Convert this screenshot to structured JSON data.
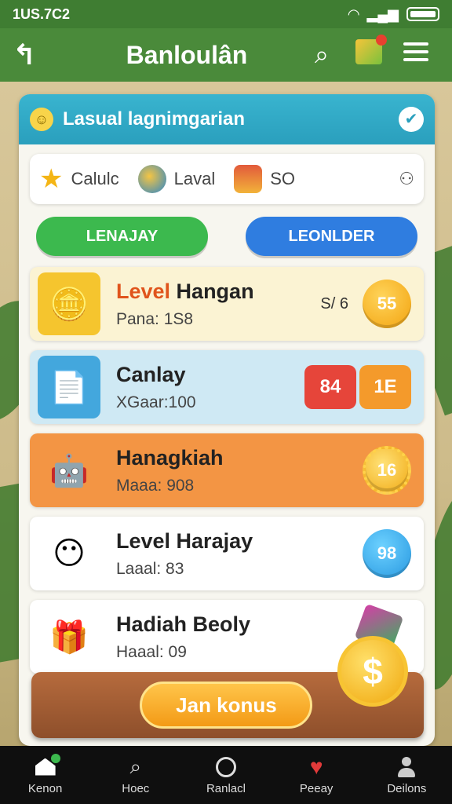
{
  "status": {
    "time": "1US.7C2"
  },
  "header": {
    "title": "Banloulân"
  },
  "panel": {
    "title": "Lasual lagnimgarian",
    "stats": [
      {
        "label": "Calulc"
      },
      {
        "label": "Laval"
      },
      {
        "label": "SO"
      }
    ]
  },
  "tabs": [
    {
      "label": "LENAJAY"
    },
    {
      "label": "LEONLDER"
    }
  ],
  "cards": [
    {
      "name_hl": "Level",
      "name_rest": " Hangan",
      "sub": "Pana: 1S8",
      "extra": "S/ 6",
      "value": "55"
    },
    {
      "name": "Canlay",
      "sub": "XGaar:100",
      "badge1": "84",
      "badge2": "1E"
    },
    {
      "name": "Hanagkiah",
      "sub": "Maaa: 908",
      "value": "16"
    },
    {
      "name": "Level Harajay",
      "sub": "Laaal: 83",
      "value": "98"
    },
    {
      "name": "Hadiah Beoly",
      "sub": "Haaal: 09"
    }
  ],
  "cta": {
    "label": "Jan konus"
  },
  "bottomnav": [
    {
      "label": "Kenon"
    },
    {
      "label": "Hoec"
    },
    {
      "label": "Ranlacl"
    },
    {
      "label": "Peeay"
    },
    {
      "label": "Deilons"
    }
  ],
  "colors": {
    "header": "#4a8a3a",
    "panel_head": "#2a9fbd",
    "tab_green": "#3cb94e",
    "tab_blue": "#2f7de0"
  }
}
